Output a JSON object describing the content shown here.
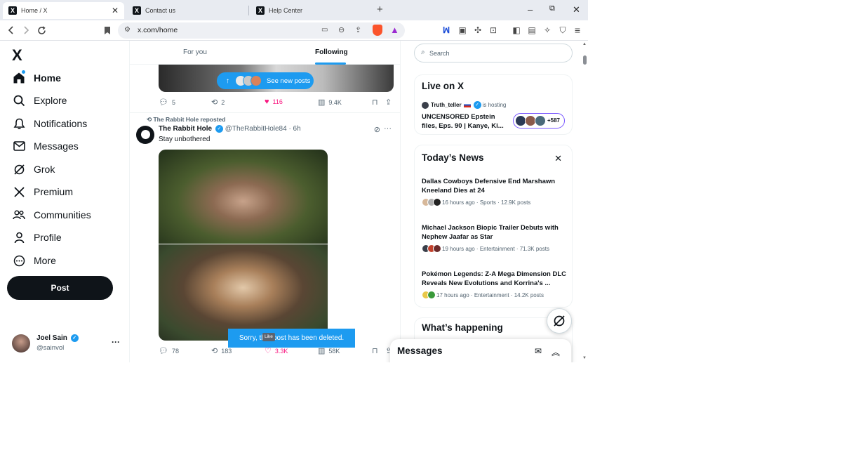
{
  "browser": {
    "tabs": [
      {
        "title": "Home / X",
        "active": true
      },
      {
        "title": "Contact us",
        "active": false
      },
      {
        "title": "Help Center",
        "active": false
      }
    ],
    "fav_glyph": "X",
    "url": "x.com/home",
    "win": {
      "minimize": "–",
      "restore": "⧉",
      "close": "✕"
    }
  },
  "nav": {
    "logo": "X",
    "items": [
      {
        "label": "Home",
        "icon": "home-icon"
      },
      {
        "label": "Explore",
        "icon": "search-icon"
      },
      {
        "label": "Notifications",
        "icon": "bell-icon"
      },
      {
        "label": "Messages",
        "icon": "mail-icon"
      },
      {
        "label": "Grok",
        "icon": "grok-icon"
      },
      {
        "label": "Premium",
        "icon": "x-icon"
      },
      {
        "label": "Communities",
        "icon": "people-icon"
      },
      {
        "label": "Profile",
        "icon": "person-icon"
      },
      {
        "label": "More",
        "icon": "more-circle-icon"
      }
    ],
    "post_label": "Post",
    "user": {
      "name": "Joel Sain",
      "handle": "@sainvol"
    }
  },
  "feed": {
    "tabs": [
      "For you",
      "Following"
    ],
    "see_new": "See new posts",
    "prev_actions": {
      "reply": "5",
      "repost": "2",
      "like": "116",
      "views": "9.4K"
    },
    "reposted_by": "The Rabbit Hole reposted",
    "post": {
      "name": "The Rabbit Hole",
      "handle": "@TheRabbitHole84 · 6h",
      "text": "Stay unbothered",
      "reply": "78",
      "repost": "183",
      "like": "3.3K",
      "views": "58K"
    },
    "toast": "Sorry, that post has been deleted.",
    "tooltip": "Like"
  },
  "right": {
    "search_placeholder": "Search",
    "live": {
      "title": "Live on X",
      "host": "Truth_teller",
      "hosting": "is hosting",
      "space_title": "UNCENSORED Epstein files, Eps. 90 | Kanye, Ki...",
      "count": "+587"
    },
    "news": {
      "title": "Today’s News",
      "items": [
        {
          "title": "Dallas Cowboys Defensive End Marshawn Kneeland Dies at 24",
          "meta": "16 hours ago · Sports · 12.9K posts"
        },
        {
          "title": "Michael Jackson Biopic Trailer Debuts with Nephew Jaafar as Star",
          "meta": "19 hours ago · Entertainment · 71.3K posts"
        },
        {
          "title": "Pokémon Legends: Z-A Mega Dimension DLC Reveals New Evolutions and Korrina's ...",
          "meta": "17 hours ago · Entertainment · 14.2K posts"
        }
      ]
    },
    "happening_title": "What’s happening",
    "messages_title": "Messages"
  },
  "colors": {
    "accent": "#1d9bf0",
    "like": "#f91880",
    "text": "#0f1419",
    "muted": "#536471"
  }
}
